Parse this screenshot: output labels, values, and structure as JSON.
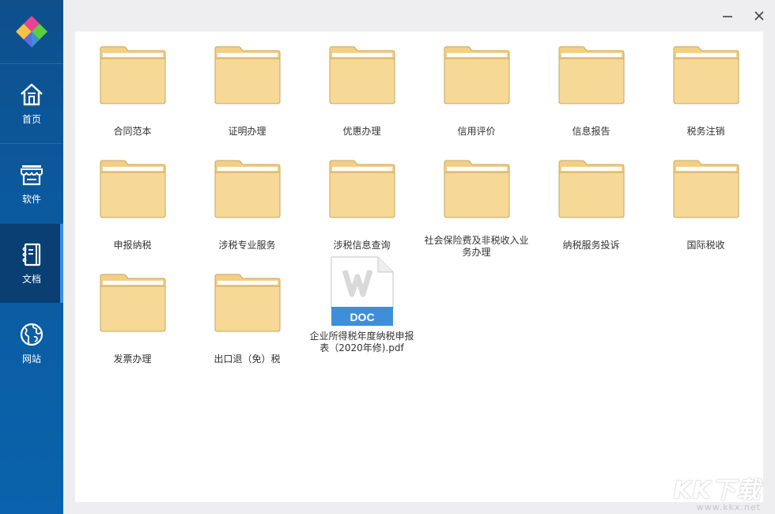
{
  "window": {
    "minimize_icon": "minimize-icon",
    "close_icon": "close-icon"
  },
  "sidebar": {
    "items": [
      {
        "label": "首页",
        "icon": "home-icon",
        "active": false
      },
      {
        "label": "软件",
        "icon": "store-icon",
        "active": false
      },
      {
        "label": "文档",
        "icon": "document-icon",
        "active": true
      },
      {
        "label": "网站",
        "icon": "globe-icon",
        "active": false
      }
    ]
  },
  "files": [
    {
      "label": "合同范本",
      "type": "folder"
    },
    {
      "label": "证明办理",
      "type": "folder"
    },
    {
      "label": "优惠办理",
      "type": "folder"
    },
    {
      "label": "信用评价",
      "type": "folder"
    },
    {
      "label": "信息报告",
      "type": "folder"
    },
    {
      "label": "税务注销",
      "type": "folder"
    },
    {
      "label": "申报纳税",
      "type": "folder"
    },
    {
      "label": "涉税专业服务",
      "type": "folder"
    },
    {
      "label": "涉税信息查询",
      "type": "folder"
    },
    {
      "label": "社会保险费及非税收入业务办理",
      "type": "folder"
    },
    {
      "label": "纳税服务投诉",
      "type": "folder"
    },
    {
      "label": "国际税收",
      "type": "folder"
    },
    {
      "label": "发票办理",
      "type": "folder"
    },
    {
      "label": "出口退（免）税",
      "type": "folder"
    },
    {
      "label": "企业所得税年度纳税申报表（2020年修).pdf",
      "type": "doc",
      "badge": "DOC"
    }
  ],
  "watermark": {
    "title": "KK下载",
    "url": "www.kkx.net"
  },
  "colors": {
    "sidebar": "#0b5a9e",
    "active": "#0a3f73",
    "folder": "#f5d794",
    "doc_badge": "#3f8fd8"
  }
}
